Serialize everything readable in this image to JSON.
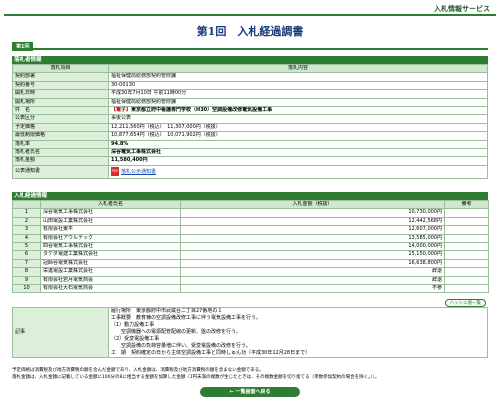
{
  "header": {
    "service_label": "入札情報サービス",
    "title": "第1回　入札経過調書"
  },
  "round_tab": "第1回",
  "info": {
    "section_label": "落札者情報",
    "col_item": "落札項目",
    "col_content": "落札内容",
    "rows": [
      {
        "label": "契約部署",
        "value": "福祉保健局総務部契約管財課"
      },
      {
        "label": "契約番号",
        "value": "30-00130"
      },
      {
        "label": "開札日時",
        "value": "平成30年7月10日 午前11時00分"
      },
      {
        "label": "開札場所",
        "value": "福祉保健局総務部契約管財課"
      },
      {
        "label": "件　名",
        "tag": "【電子】",
        "value": "東京都立府中看護専門学校（H30）空調設備改修電気設備工事"
      },
      {
        "label": "公表区分",
        "value": "事後公表"
      },
      {
        "label": "予定価格",
        "value": "12,211,560円（税込）　11,307,000円（税抜）"
      },
      {
        "label": "最低制限価格",
        "value": "10,877,654円（税込）　10,071,902円（税抜）"
      },
      {
        "label": "落札率",
        "value": "94.8%"
      },
      {
        "label": "落札者氏名",
        "value": "深谷電気工事株式会社"
      },
      {
        "label": "落札金額",
        "value": "11,580,400円"
      }
    ],
    "notice_label": "公表通知書",
    "notice_link": "落札公示通知書"
  },
  "bids": {
    "section_label": "入札経過情報",
    "col_name": "入札者氏名",
    "col_amount": "入札金額（税抜）",
    "col_remarks": "備考",
    "rows": [
      {
        "no": "1",
        "name": "深谷電気工事株式会社",
        "amount": "10,730,000円",
        "remark": ""
      },
      {
        "no": "2",
        "name": "山田電設工業株式会社",
        "amount": "12,442,568円",
        "remark": ""
      },
      {
        "no": "3",
        "name": "有限会社東平",
        "amount": "12,607,000円",
        "remark": ""
      },
      {
        "no": "4",
        "name": "有限会社アウルテック",
        "amount": "13,585,000円",
        "remark": ""
      },
      {
        "no": "5",
        "name": "四谷電気工事株式会社",
        "amount": "14,000,000円",
        "remark": ""
      },
      {
        "no": "6",
        "name": "タケダ電建工業株式会社",
        "amount": "15,150,000円",
        "remark": ""
      },
      {
        "no": "7",
        "name": "冠師谷電気株式会社",
        "amount": "16,638,800円",
        "remark": ""
      },
      {
        "no": "8",
        "name": "栄進電設工業株式会社",
        "amount": "辞退",
        "remark": ""
      },
      {
        "no": "9",
        "name": "有限会社岩月電気商会",
        "amount": "辞退",
        "remark": ""
      },
      {
        "no": "10",
        "name": "有限会社大石電気商会",
        "amount": "不参",
        "remark": ""
      }
    ],
    "hash_button": "ハッシュ値一覧"
  },
  "remarks": {
    "label": "記事",
    "lines": [
      "履行場所　東京都府中市武蔵台二丁目27番地の１",
      "工事概要　教育棟の空調設備改修工事に伴う電気設備工事を行う。",
      "（1）動力設備工事",
      "　　空調機器への電源配管配線の更新、盤の改修を行う。",
      "（2）受変電設備工事",
      "　　空調設備の負荷容量増に伴い、受変電設備の改修を行う。",
      "工　期　契約確定の日から主体空調設備工事と同時しゅん功（平成30年12月28日まで）"
    ]
  },
  "notes": [
    "予定価格は消費税及び地方消費税の額を含んだ金額であり、入札金額は、消費税及び地方消費税の額を含まない金額である。",
    "落札金額は、入札金額に記載している金額に100分の8に相当する金額を加算した金額（1円未満の端数が生じたときは、その端数金額を切り捨てる（単数参加契約の場合を除く。））。"
  ],
  "back_button": "← 一覧画面へ戻る"
}
